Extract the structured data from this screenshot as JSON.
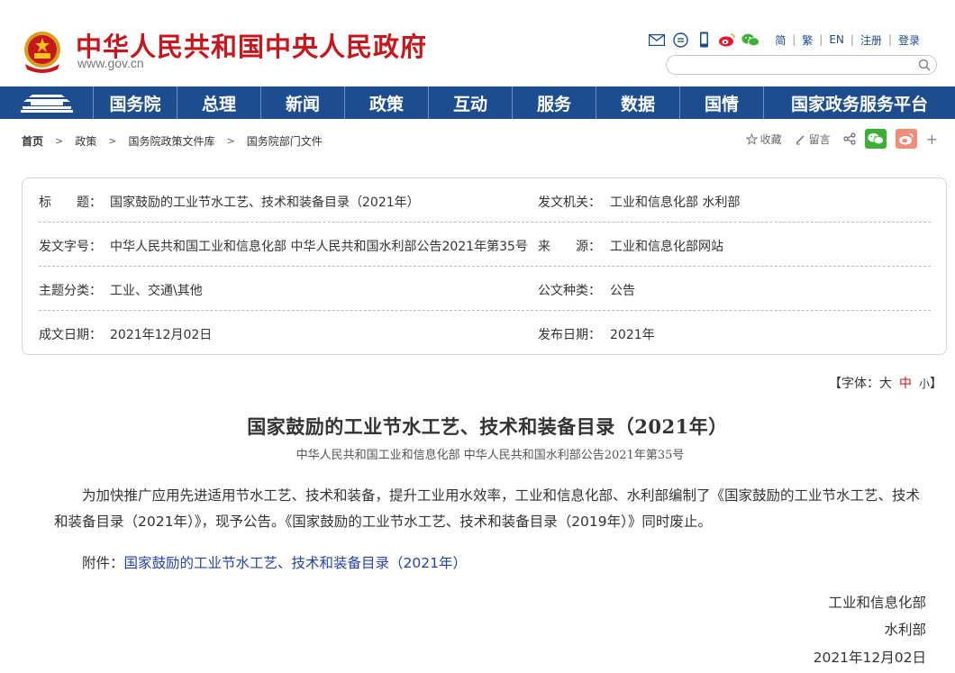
{
  "header": {
    "site_name": "中华人民共和国中央人民政府",
    "site_domain": "www.gov.cn",
    "links": [
      "简",
      "繁",
      "EN",
      "注册",
      "登录"
    ],
    "search": {
      "value": "",
      "placeholder": ""
    },
    "icons": [
      "mail-icon",
      "message-icon",
      "phone-icon",
      "weibo-icon",
      "wechat-icon"
    ]
  },
  "nav": [
    "国务院",
    "总理",
    "新闻",
    "政策",
    "互动",
    "服务",
    "数据",
    "国情",
    "国家政务服务平台"
  ],
  "breadcrumb": [
    "首页",
    "政策",
    "国务院政策文件库",
    "国务院部门文件"
  ],
  "tools": {
    "favorite": "收藏",
    "comment": "留言"
  },
  "info": {
    "title_label": "标　　题：",
    "title_value": "国家鼓励的工业节水工艺、技术和装备目录（2021年）",
    "issuer_label": "发文机关：",
    "issuer_value": "工业和信息化部 水利部",
    "docno_label": "发文字号：",
    "docno_value": "中华人民共和国工业和信息化部 中华人民共和国水利部公告2021年第35号",
    "source_label": "来　　源：",
    "source_value": "工业和信息化部网站",
    "topic_label": "主题分类：",
    "topic_value": "工业、交通\\其他",
    "type_label": "公文种类：",
    "type_value": "公告",
    "written_label": "成文日期：",
    "written_value": "2021年12月02日",
    "published_label": "发布日期：",
    "published_value": "2021年"
  },
  "fontsize": {
    "prefix": "【字体：",
    "large": "大",
    "medium": "中",
    "small": "小",
    "suffix": "】"
  },
  "article": {
    "title": "国家鼓励的工业节水工艺、技术和装备目录（2021年）",
    "subtitle": "中华人民共和国工业和信息化部 中华人民共和国水利部公告2021年第35号",
    "paragraph": "为加快推广应用先进适用节水工艺、技术和装备，提升工业用水效率，工业和信息化部、水利部编制了《国家鼓励的工业节水工艺、技术和装备目录（2021年）》，现予公告。《国家鼓励的工业节水工艺、技术和装备目录（2019年）》同时废止。",
    "attachment_label": "附件：",
    "attachment_link": "国家鼓励的工业节水工艺、技术和装备目录（2021年）",
    "sign_1": "工业和信息化部",
    "sign_2": "水利部",
    "sign_date": "2021年12月02日"
  },
  "colors": {
    "brand_red": "#c8161d",
    "nav_blue": "#1d4d8f",
    "link_blue": "#2443ab"
  }
}
